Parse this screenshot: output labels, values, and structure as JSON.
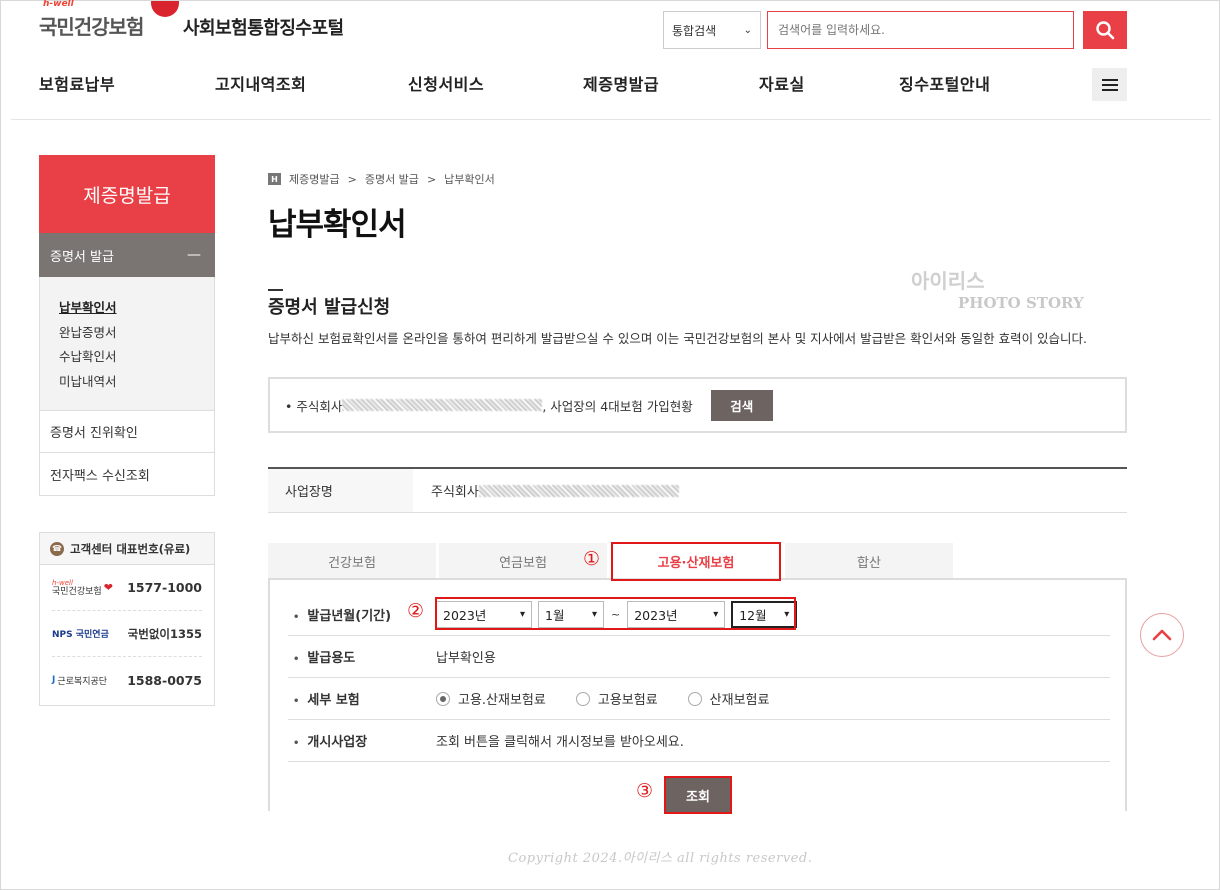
{
  "header": {
    "brand_tag": "h-well",
    "brand_name": "국민건강보험",
    "portal_title": "사회보험통합징수포털",
    "search_scope": "통합검색",
    "search_placeholder": "검색어를 입력하세요.",
    "accent_color": "#e94048"
  },
  "gnb": [
    "보험료납부",
    "고지내역조회",
    "신청서비스",
    "제증명발급",
    "자료실",
    "징수포털안내"
  ],
  "sidebar": {
    "title": "제증명발급",
    "sub_title": "증명서 발급",
    "sub_items": [
      "납부확인서",
      "완납증명서",
      "수납확인서",
      "미납내역서"
    ],
    "items": [
      "증명서 진위확인",
      "전자팩스 수신조회"
    ],
    "cs_title": "고객센터 대표번호(유료)",
    "cs_rows": [
      {
        "org": "국민건강보험",
        "tag": "h-well",
        "number": "1577-1000"
      },
      {
        "org": "NPS 국민연금",
        "number": "국번없이1355"
      },
      {
        "org": "근로복지공단",
        "number": "1588-0075"
      }
    ]
  },
  "breadcrumb": [
    "제증명발급",
    "증명서 발급",
    "납부확인서"
  ],
  "page_title": "납부확인서",
  "section": {
    "title": "증명서 발급신청",
    "description": "납부하신 보험료확인서를 온라인을 통하여 편리하게 발급받으실 수 있으며 이는 국민건강보험의 본사 및 지사에서 발급받은 확인서와 동일한 효력이 있습니다."
  },
  "info_box": {
    "prefix": "• 주식회사",
    "suffix": ", 사업장의 4대보험 가입현황",
    "button": "검색"
  },
  "business": {
    "label": "사업장명",
    "value_prefix": "주식회사"
  },
  "tabs": [
    "건강보험",
    "연금보험",
    "고용·산재보험",
    "합산"
  ],
  "active_tab": 2,
  "form": {
    "period_label": "발급년월(기간)",
    "from_year": "2023년",
    "from_month": "1월",
    "tilde": "~",
    "to_year": "2023년",
    "to_month": "12월",
    "purpose_label": "발급용도",
    "purpose_value": "납부확인용",
    "detail_label": "세부 보험",
    "detail_options": [
      "고용.산재보험료",
      "고용보험료",
      "산재보험료"
    ],
    "detail_selected": 0,
    "site_label": "개시사업장",
    "site_value": "조회 버튼을 클릭해서 개시정보를 받아오세요.",
    "query_button": "조회"
  },
  "annotations": [
    "①",
    "②",
    "③"
  ],
  "watermark": {
    "line1": "아이리스",
    "line2": "PHOTO STORY"
  },
  "copyright": "Copyright 2024.아이리스 all rights reserved."
}
